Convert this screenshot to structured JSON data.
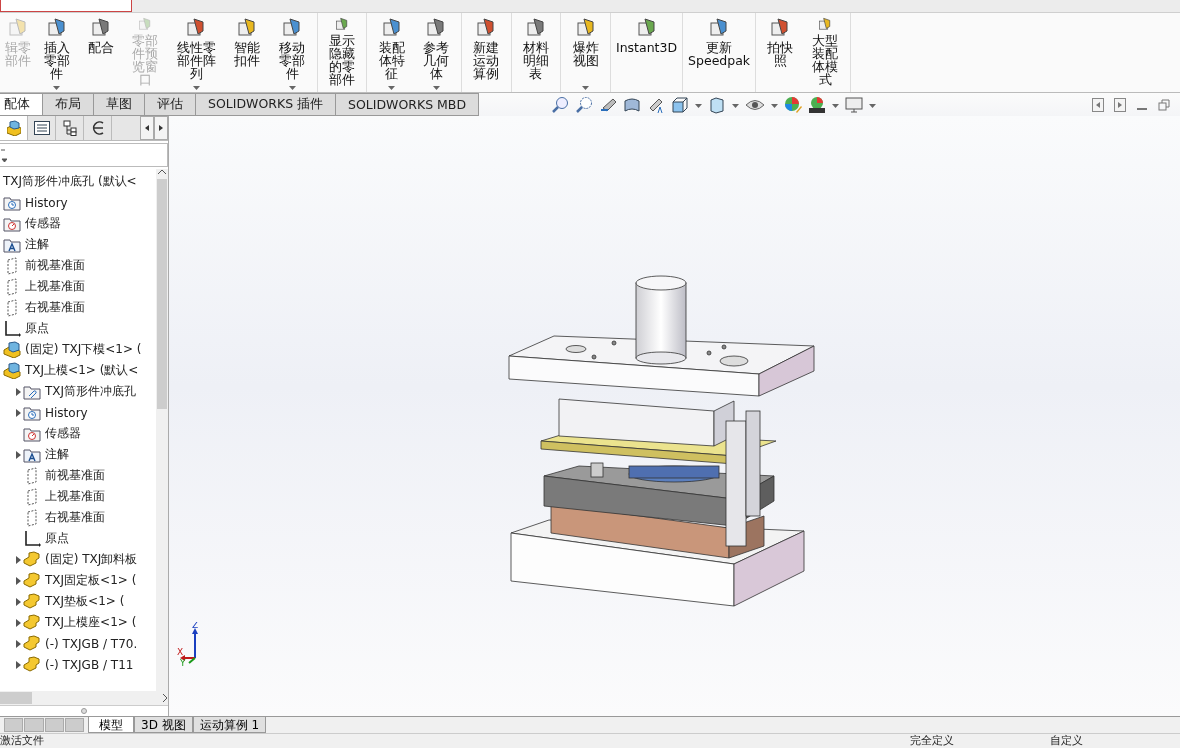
{
  "ribbon": {
    "groups": [
      {
        "buttons": [
          {
            "label": "辑零部件",
            "disabled": true,
            "dropdown": false
          },
          {
            "label": "插入零部件",
            "disabled": false,
            "dropdown": true
          },
          {
            "label": "配合",
            "disabled": false,
            "dropdown": false
          },
          {
            "label": "零部件预览窗口",
            "disabled": true,
            "dropdown": false
          },
          {
            "label": "线性零部件阵列",
            "disabled": false,
            "dropdown": true
          },
          {
            "label": "智能扣件",
            "disabled": false,
            "dropdown": false
          },
          {
            "label": "移动零部件",
            "disabled": false,
            "dropdown": true
          }
        ]
      },
      {
        "buttons": [
          {
            "label": "显示隐藏的零部件",
            "disabled": false,
            "dropdown": false
          }
        ]
      },
      {
        "buttons": [
          {
            "label": "装配体特征",
            "disabled": false,
            "dropdown": true
          },
          {
            "label": "参考几何体",
            "disabled": false,
            "dropdown": true
          }
        ]
      },
      {
        "buttons": [
          {
            "label": "新建运动算例",
            "disabled": false,
            "dropdown": false
          }
        ]
      },
      {
        "buttons": [
          {
            "label": "材料明细表",
            "disabled": false,
            "dropdown": false
          }
        ]
      },
      {
        "buttons": [
          {
            "label": "爆炸视图",
            "disabled": false,
            "dropdown": true
          }
        ]
      },
      {
        "buttons": [
          {
            "label": "Instant3D",
            "disabled": false,
            "dropdown": false
          }
        ]
      },
      {
        "buttons": [
          {
            "label": "更新 Speedpak",
            "disabled": false,
            "dropdown": false
          }
        ]
      },
      {
        "buttons": [
          {
            "label": "拍快照",
            "disabled": false,
            "dropdown": false
          },
          {
            "label": "大型装配体模式",
            "disabled": false,
            "dropdown": false
          }
        ]
      }
    ]
  },
  "command_tabs": [
    {
      "label": "配体",
      "selected": true
    },
    {
      "label": "布局",
      "selected": false
    },
    {
      "label": "草图",
      "selected": false
    },
    {
      "label": "评估",
      "selected": false
    },
    {
      "label": "SOLIDWORKS 插件",
      "selected": false
    },
    {
      "label": "SOLIDWORKS MBD",
      "selected": false
    }
  ],
  "feature_tree": [
    {
      "kind": "root",
      "label": "TXJ筒形件冲底孔 (默认<"
    },
    {
      "kind": "history",
      "label": "History"
    },
    {
      "kind": "sensor",
      "label": "传感器"
    },
    {
      "kind": "annotation",
      "label": "注解"
    },
    {
      "kind": "plane",
      "label": "前视基准面"
    },
    {
      "kind": "plane",
      "label": "上视基准面"
    },
    {
      "kind": "plane",
      "label": "右视基准面"
    },
    {
      "kind": "origin",
      "label": "原点"
    },
    {
      "kind": "assembly",
      "label": "(固定) TXJ下模<1> ("
    },
    {
      "kind": "assembly",
      "label": "TXJ上模<1> (默认<",
      "children": [
        {
          "kind": "part-folder",
          "label": "TXJ筒形件冲底孔",
          "expanded": false
        },
        {
          "kind": "history",
          "label": "History",
          "expanded": false
        },
        {
          "kind": "sensor",
          "label": "传感器"
        },
        {
          "kind": "annotation",
          "label": "注解",
          "expanded": false
        },
        {
          "kind": "plane",
          "label": "前视基准面"
        },
        {
          "kind": "plane",
          "label": "上视基准面"
        },
        {
          "kind": "plane",
          "label": "右视基准面"
        },
        {
          "kind": "origin",
          "label": "原点"
        },
        {
          "kind": "part",
          "label": "(固定) TXJ卸料板",
          "expanded": false
        },
        {
          "kind": "part",
          "label": "TXJ固定板<1> (",
          "expanded": false
        },
        {
          "kind": "part",
          "label": "TXJ垫板<1> (",
          "expanded": false
        },
        {
          "kind": "part",
          "label": "TXJ上模座<1> (",
          "expanded": false
        },
        {
          "kind": "part",
          "label": "(-) TXJGB / T70.",
          "expanded": false
        },
        {
          "kind": "part",
          "label": "(-) TXJGB / T11",
          "expanded": false
        }
      ]
    }
  ],
  "triad": {
    "x": "X",
    "y": "Y",
    "z": "Z"
  },
  "bottom_tabs": [
    {
      "label": "模型",
      "selected": true
    },
    {
      "label": "3D 视图",
      "selected": false
    },
    {
      "label": "运动算例 1",
      "selected": false
    }
  ],
  "status_bar": [
    "激活文件",
    "完全定义",
    "自定义"
  ]
}
